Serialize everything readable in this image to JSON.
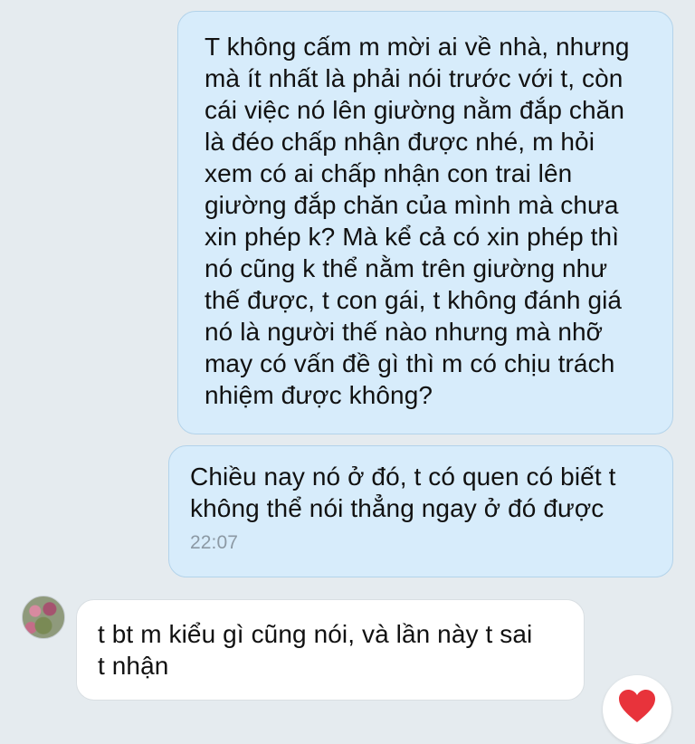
{
  "messages": [
    {
      "direction": "outgoing",
      "text": "T không cấm m mời ai về nhà, nhưng\nmà ít nhất là phải nói trước với t, còn\ncái việc nó lên giường nằm đắp chăn\nlà đéo chấp nhận được nhé, m hỏi\nxem có ai chấp nhận con trai lên\ngiường đắp chăn của mình mà chưa\nxin phép k? Mà kể cả có xin phép thì\nnó cũng k thể nằm trên giường như\nthế được, t con gái, t không đánh giá\nnó là người thế nào nhưng mà nhỡ\nmay có vấn đề gì thì m có chịu trách\nnhiệm được không?"
    },
    {
      "direction": "outgoing",
      "text": "Chiều nay nó ở đó, t có quen có biết t\nkhông thể nói thẳng ngay ở đó được",
      "time": "22:07"
    },
    {
      "direction": "incoming",
      "text": "t bt m kiểu gì cũng nói, và lần này t sai\nt nhận"
    }
  ],
  "reaction": {
    "icon": "heart-icon",
    "color": "#e8333b"
  },
  "colors": {
    "background": "#e5ebef",
    "outgoing_bubble": "#d7ecfb",
    "incoming_bubble": "#ffffff",
    "timestamp": "#8c99a4"
  }
}
